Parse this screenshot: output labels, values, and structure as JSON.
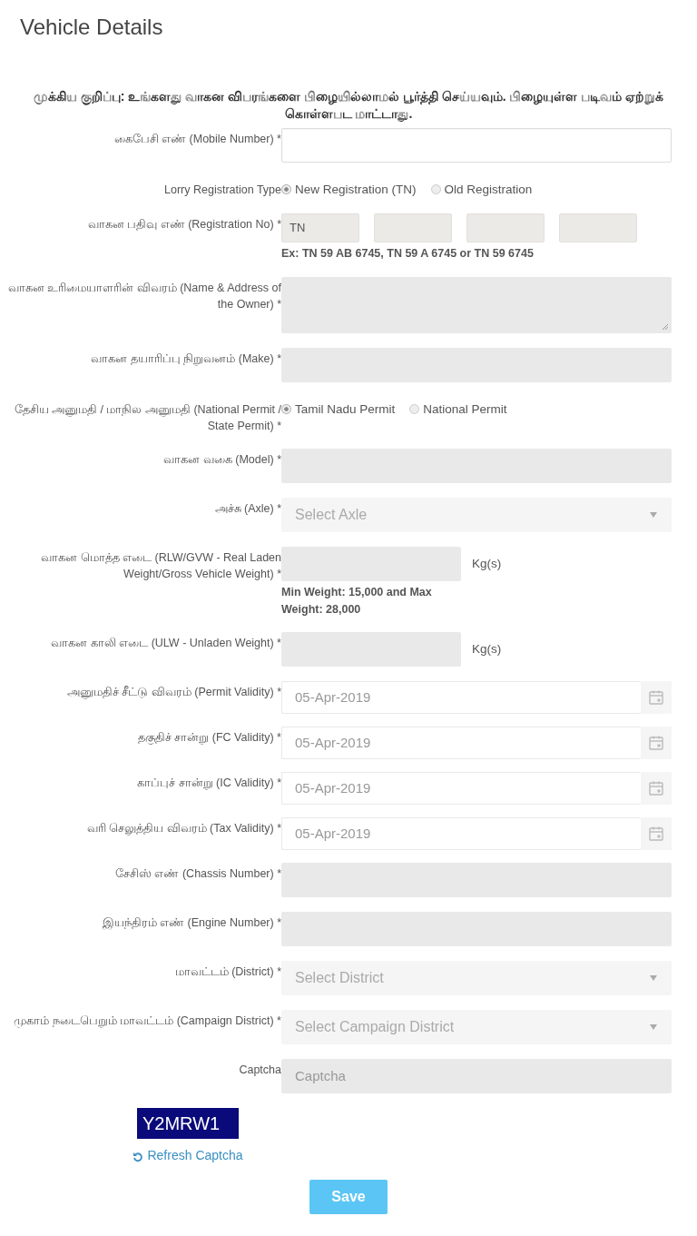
{
  "title": "Vehicle Details",
  "notice": "முக்கிய குறிப்பு: உங்களது வாகன விபரங்களை பிழையில்லாமல் பூர்த்தி செய்யவும். பிழையுள்ள படிவம் ஏற்றுக் கொள்ளபட மாட்டாது.",
  "fields": [
    {
      "kind": "plain",
      "label": "கைபேசி எண் (Mobile Number) *"
    },
    {
      "kind": "radio",
      "label": "Lorry Registration Type",
      "options": [
        {
          "label": "New Registration (TN)",
          "selected": true
        },
        {
          "label": "Old Registration",
          "selected": false
        }
      ]
    },
    {
      "kind": "regno",
      "label": "வாகன பதிவு எண் (Registration No) *",
      "value": "TN",
      "hint": "Ex: TN 59 AB 6745, TN 59 A 6745 or TN 59 6745"
    },
    {
      "kind": "textarea",
      "label": "வாகன உரிமையாளரின் விவரம் (Name & Address of the Owner) *"
    },
    {
      "kind": "text",
      "label": "வாகன தயாரிப்பு நிறுவனம் (Make) *"
    },
    {
      "kind": "radio",
      "label": "தேசிய அனுமதி / மாநில அனுமதி (National Permit / State Permit) *",
      "options": [
        {
          "label": "Tamil Nadu Permit",
          "selected": true
        },
        {
          "label": "National Permit",
          "selected": false
        }
      ]
    },
    {
      "kind": "text",
      "label": "வாகன வகை (Model) *"
    },
    {
      "kind": "select",
      "label": "அச்சு (Axle) *",
      "placeholder": "Select Axle"
    },
    {
      "kind": "weight",
      "label": "வாகன மொத்த எடை (RLW/GVW - Real Laden Weight/Gross Vehicle Weight) *",
      "unit": "Kg(s)",
      "hint": "Min Weight: 15,000 and Max Weight: 28,000"
    },
    {
      "kind": "weight",
      "label": "வாகன காலி எடை (ULW - Unladen Weight) *",
      "unit": "Kg(s)"
    },
    {
      "kind": "date",
      "label": "அனுமதிச் சீட்டு விவரம் (Permit Validity) *",
      "value": "05-Apr-2019"
    },
    {
      "kind": "date",
      "label": "தகுதிச் சான்று (FC Validity) *",
      "value": "05-Apr-2019"
    },
    {
      "kind": "date",
      "label": "காப்புச் சான்று (IC Validity) *",
      "value": "05-Apr-2019"
    },
    {
      "kind": "date",
      "label": "வரி செலுத்திய விவரம் (Tax Validity) *",
      "value": "05-Apr-2019"
    },
    {
      "kind": "text",
      "label": "சேசிஸ் எண் (Chassis Number) *"
    },
    {
      "kind": "text",
      "label": "இயந்திரம் எண் (Engine Number) *"
    },
    {
      "kind": "select",
      "label": "மாவட்டம் (District) *",
      "placeholder": "Select District"
    },
    {
      "kind": "select",
      "label": "முகாம் நடைபெறும் மாவட்டம் (Campaign District) *",
      "placeholder": "Select Campaign District"
    },
    {
      "kind": "captcha",
      "label": "Captcha",
      "placeholder": "Captcha"
    }
  ],
  "captcha": {
    "code": "Y2MRW1",
    "refresh": "Refresh Captcha"
  },
  "save": "Save"
}
